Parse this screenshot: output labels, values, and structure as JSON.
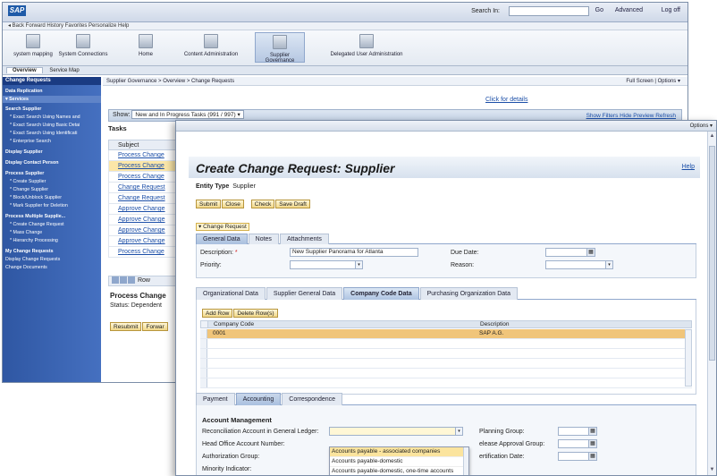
{
  "back": {
    "logo": "SAP",
    "search_label": "Search In:",
    "go": "Go",
    "advanced": "Advanced",
    "logoff": "Log off",
    "navline": "◂ Back   Forward      History  Favorites  Personalize  Help",
    "icons": [
      {
        "label": "system mapping"
      },
      {
        "label": "System Connections"
      },
      {
        "label": "Home"
      },
      {
        "label": "Content Administration"
      },
      {
        "label": "Supplier Governance"
      },
      {
        "label": "Delegated User Administration"
      }
    ],
    "subtabs": [
      "Overview",
      "Service Map"
    ],
    "leftnav": {
      "header": "Change Requests",
      "items": [
        {
          "text": "Data Replication",
          "type": "grp"
        },
        {
          "text": "▾   Services",
          "type": "sep"
        },
        {
          "text": "Search Supplier",
          "type": "grp"
        },
        {
          "text": "* Exact Search Using Names and",
          "type": "sub"
        },
        {
          "text": "* Exact Search Using Basic Detai",
          "type": "sub"
        },
        {
          "text": "* Exact Search Using Identificati",
          "type": "sub"
        },
        {
          "text": "* Enterprise Search",
          "type": "sub"
        },
        {
          "text": "Display Supplier",
          "type": "grp"
        },
        {
          "text": "Display Contact Person",
          "type": "grp"
        },
        {
          "text": "Process Supplier",
          "type": "grp"
        },
        {
          "text": "* Create Supplier",
          "type": "sub"
        },
        {
          "text": "* Change Supplier",
          "type": "sub"
        },
        {
          "text": "* Block/Unblock Supplier",
          "type": "sub"
        },
        {
          "text": "* Mark Supplier for Deletion",
          "type": "sub"
        },
        {
          "text": "Process Multiple Supplie...",
          "type": "grp"
        },
        {
          "text": "* Create Change Request",
          "type": "sub"
        },
        {
          "text": "* Mass Change",
          "type": "sub"
        },
        {
          "text": "* Hierarchy Processing",
          "type": "sub"
        },
        {
          "text": "My Change Requests",
          "type": "grp"
        },
        {
          "text": "Display Change Requests",
          "type": "row"
        },
        {
          "text": "Change Documents",
          "type": "row"
        }
      ]
    },
    "breadcrumb": "Supplier Governance  >  Overview  >  Change Requests",
    "fullscreen": "Full Screen  |  Options ▾",
    "click_details": "Click for details",
    "show_label": "Show:",
    "show_value": "New and In Progress Tasks  (991 / 997)",
    "show_links": "Show Filters  Hide Preview  Refresh",
    "tasks_title": "Tasks",
    "subject_header": "Subject",
    "task_rows": [
      "Process Change",
      "Process Change",
      "Process Change",
      "Change Request",
      "Change Request",
      "Approve Change",
      "Approve Change",
      "Approve Change",
      "Approve Change",
      "Process Change"
    ],
    "pager_label": "Row",
    "process_title": "Process Change",
    "status_text": "Status:  Dependent",
    "resubmit": "Resubmit",
    "forward": "Forwar"
  },
  "front": {
    "options": "Options ▾",
    "title": "Create Change Request: Supplier",
    "help": "Help",
    "entity_type_label": "Entity Type",
    "entity_type_value": "Supplier",
    "buttons": [
      "Submit",
      "Close",
      "Check",
      "Save Draft"
    ],
    "change_request_label": "▾ Change Request",
    "tabs1": [
      "General Data",
      "Notes",
      "Attachments"
    ],
    "description_label": "Description:",
    "description_value": "New Supplier Panorama for Atlanta",
    "priority_label": "Priority:",
    "due_date_label": "Due Date:",
    "reason_label": "Reason:",
    "tabs2": [
      "Organizational Data",
      "Supplier General Data",
      "Company Code Data",
      "Purchasing Organization Data"
    ],
    "add_row": "Add Row",
    "delete_rows": "Delete Row(s)",
    "col_company_code": "Company Code",
    "col_description": "Description",
    "cc_rows": [
      {
        "code": "0001",
        "desc": "SAP A.G."
      }
    ],
    "tabs3": [
      "Payment",
      "Accounting",
      "Correspondence"
    ],
    "account_mgmt": "Account Management",
    "recon_label": "Reconciliation Account in General Ledger:",
    "head_office_label": "Head Office Account Number:",
    "auth_group_label": "Authorization Group:",
    "minority_label": "Minority Indicator:",
    "planning_group_label": "Planning Group:",
    "release_group_label": "elease Approval Group:",
    "cert_date_label": "ertification Date:",
    "dropdown_options": [
      "Accounts payable - associated companies",
      "Accounts payable-domestic",
      "Accounts payable-domestic, one-time accounts"
    ]
  }
}
